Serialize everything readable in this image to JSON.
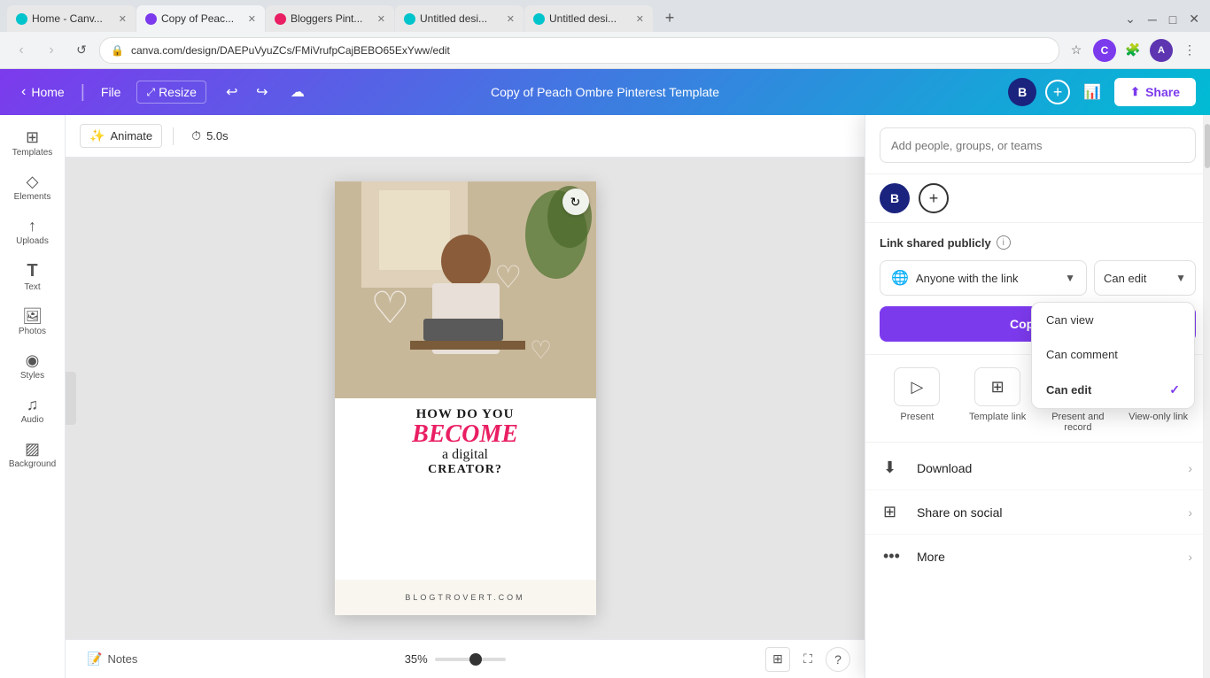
{
  "browser": {
    "tabs": [
      {
        "id": "tab1",
        "favicon": "canva",
        "title": "Home - Canv...",
        "active": false
      },
      {
        "id": "tab2",
        "favicon": "canva2",
        "title": "Copy of Peac...",
        "active": true
      },
      {
        "id": "tab3",
        "favicon": "bloggers",
        "title": "Bloggers Pint...",
        "active": false
      },
      {
        "id": "tab4",
        "favicon": "untitled",
        "title": "Untitled desi...",
        "active": false
      },
      {
        "id": "tab5",
        "favicon": "untitled",
        "title": "Untitled desi...",
        "active": false
      }
    ],
    "address": "canva.com/design/DAEPuVyuZCs/FMiVrufpCajBEBO65ExYww/edit"
  },
  "topbar": {
    "home_label": "Home",
    "file_label": "File",
    "resize_label": "Resize",
    "title": "Copy of Peach Ombre Pinterest Template",
    "share_label": "Share"
  },
  "sidebar": {
    "items": [
      {
        "id": "templates",
        "icon": "⊞",
        "label": "Templates"
      },
      {
        "id": "elements",
        "icon": "◇",
        "label": "Elements"
      },
      {
        "id": "uploads",
        "icon": "↑",
        "label": "Uploads"
      },
      {
        "id": "text",
        "icon": "T",
        "label": "Text"
      },
      {
        "id": "photos",
        "icon": "🖼",
        "label": "Photos"
      },
      {
        "id": "styles",
        "icon": "◉",
        "label": "Styles"
      },
      {
        "id": "audio",
        "icon": "♫",
        "label": "Audio"
      },
      {
        "id": "background",
        "icon": "▨",
        "label": "Background"
      }
    ]
  },
  "canvas": {
    "animate_label": "Animate",
    "timing_label": "5.0s",
    "design": {
      "how_text": "HOW DO YOU",
      "become_text": "BECOME",
      "digital_text": "a digital",
      "creator_text": "CREATOR?",
      "url_text": "BLOGTROVERT.COM"
    },
    "zoom_value": "35%",
    "notes_label": "Notes"
  },
  "share_panel": {
    "people_placeholder": "Add people, groups, or teams",
    "user_initial": "B",
    "link_label": "Link shared publicly",
    "who_options": [
      {
        "id": "anyone",
        "label": "Anyone with the link"
      }
    ],
    "who_selected": "Anyone with the link",
    "perm_options": [
      {
        "id": "can_view",
        "label": "Can view",
        "selected": false
      },
      {
        "id": "can_comment",
        "label": "Can comment",
        "selected": false
      },
      {
        "id": "can_edit",
        "label": "Can edit",
        "selected": true
      }
    ],
    "perm_selected": "Can edit",
    "copy_link_label": "Copy link",
    "action_items": [
      {
        "id": "present",
        "icon": "▷",
        "label": "Present"
      },
      {
        "id": "template_link",
        "icon": "⊞",
        "label": "Template link"
      },
      {
        "id": "present_record",
        "icon": "⬜",
        "label": "Present and record"
      },
      {
        "id": "view_only_link",
        "icon": "🔗",
        "label": "View-only link"
      }
    ],
    "extra_items": [
      {
        "id": "download",
        "icon": "⬇",
        "label": "Download"
      },
      {
        "id": "share_social",
        "icon": "⊞",
        "label": "Share on social"
      },
      {
        "id": "more",
        "icon": "•••",
        "label": "More"
      }
    ]
  }
}
